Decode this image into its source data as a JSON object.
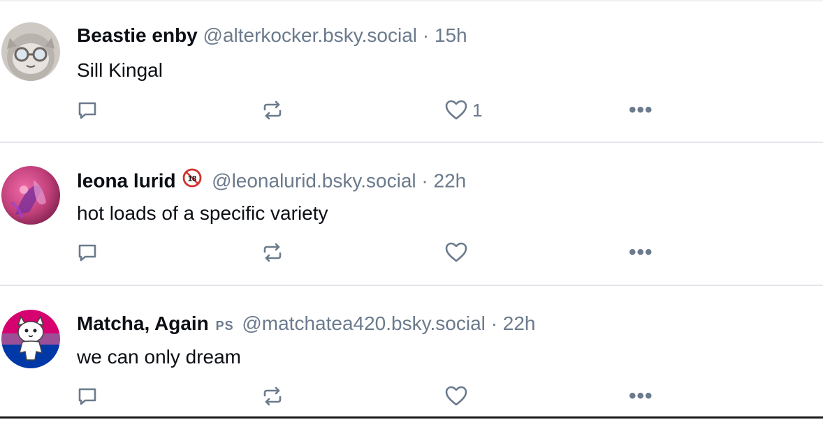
{
  "feed": {
    "posts": [
      {
        "display_name": "Beastie enby",
        "handle": "@alterkocker.bsky.social",
        "separator": "·",
        "time": "15h",
        "text": "Sill Kingal",
        "like_count": "1",
        "more_label": "•••",
        "avatar_icon": "gray-cat-face-avatar",
        "colors": {
          "avatar_bg": "#c9c4c0",
          "avatar_accent": "#d9e2ea"
        }
      },
      {
        "display_name": "leona lurid",
        "badge_icon": "18-plus-badge-icon",
        "handle": "@leonalurid.bsky.social",
        "separator": "·",
        "time": "22h",
        "text": "hot loads of a specific variety",
        "like_count": "",
        "more_label": "•••",
        "avatar_icon": "pink-abstract-avatar",
        "colors": {
          "avatar_bg": "#c0407a",
          "avatar_accent": "#7a2f9a"
        }
      },
      {
        "display_name": "Matcha, Again",
        "name_suffix": "PS",
        "handle": "@matchatea420.bsky.social",
        "separator": "·",
        "time": "22h",
        "text": "we can only dream",
        "like_count": "",
        "more_label": "•••",
        "avatar_icon": "white-cat-bi-flag-avatar",
        "colors": {
          "flag_top": "#d60270",
          "flag_mid": "#9b4f96",
          "flag_bottom": "#0038a8"
        }
      }
    ]
  },
  "colors": {
    "muted_text": "#6b7a8c",
    "icon_stroke": "#6b7a8c",
    "divider": "#e2e6ec",
    "badge_red": "#d0312d"
  }
}
